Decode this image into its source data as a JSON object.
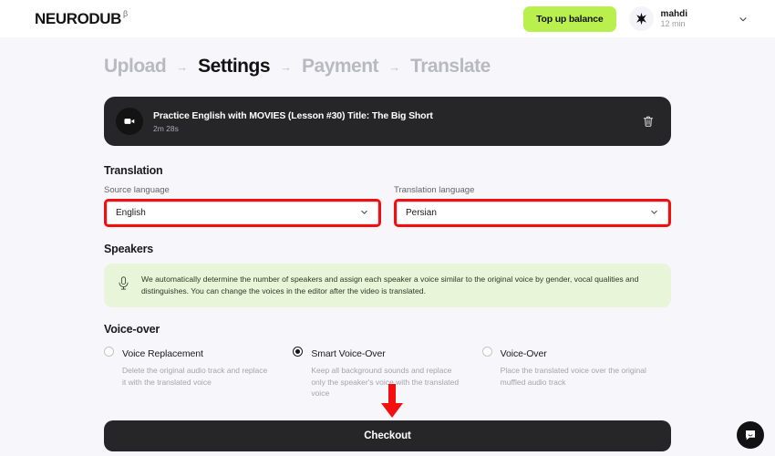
{
  "header": {
    "logo": "NEURODUB",
    "logo_sup": "β",
    "topup_label": "Top up balance",
    "topup_color": "#b9f04e",
    "user": {
      "name": "mahdi",
      "subtitle": "12 min",
      "avatar_icon": "star-burst-icon"
    },
    "menu_chevron_icon": "chevron-down-icon"
  },
  "steps": [
    {
      "label": "Upload",
      "active": false
    },
    {
      "label": "Settings",
      "active": true
    },
    {
      "label": "Payment",
      "active": false
    },
    {
      "label": "Translate",
      "active": false
    }
  ],
  "step_arrow": "→",
  "video": {
    "icon": "video-camera-icon",
    "title": "Practice English with MOVIES (Lesson #30) Title: The Big Short",
    "duration": "2m 28s",
    "delete_icon": "trash-icon"
  },
  "translation": {
    "section_title": "Translation",
    "source": {
      "label": "Source language",
      "value": "English",
      "chevron_icon": "chevron-down-icon",
      "highlight_color": "#f40f0f"
    },
    "target": {
      "label": "Translation language",
      "value": "Persian",
      "chevron_icon": "chevron-down-icon",
      "highlight_color": "#f40f0f"
    }
  },
  "speakers": {
    "section_title": "Speakers",
    "icon": "microphone-icon",
    "notice": "We automatically determine the number of speakers and assign each speaker a voice similar to the original voice by gender, vocal qualities and distinguishes. You can change the voices in the editor after the video is translated.",
    "notice_bg": "#e8f5d9"
  },
  "voiceover": {
    "section_title": "Voice-over",
    "options": [
      {
        "label": "Voice Replacement",
        "description": "Delete the original audio track and replace it with the translated voice",
        "selected": false
      },
      {
        "label": "Smart Voice-Over",
        "description": "Keep all background sounds and replace only the speaker's voice with the translated voice",
        "selected": true
      },
      {
        "label": "Voice-Over",
        "description": "Place the translated voice over the original muffled audio track",
        "selected": false
      }
    ]
  },
  "annotation": {
    "arrow_icon": "down-arrow-icon",
    "arrow_color": "#f40f0f"
  },
  "checkout": {
    "label": "Checkout"
  },
  "chat": {
    "icon": "chat-bubble-icon"
  }
}
